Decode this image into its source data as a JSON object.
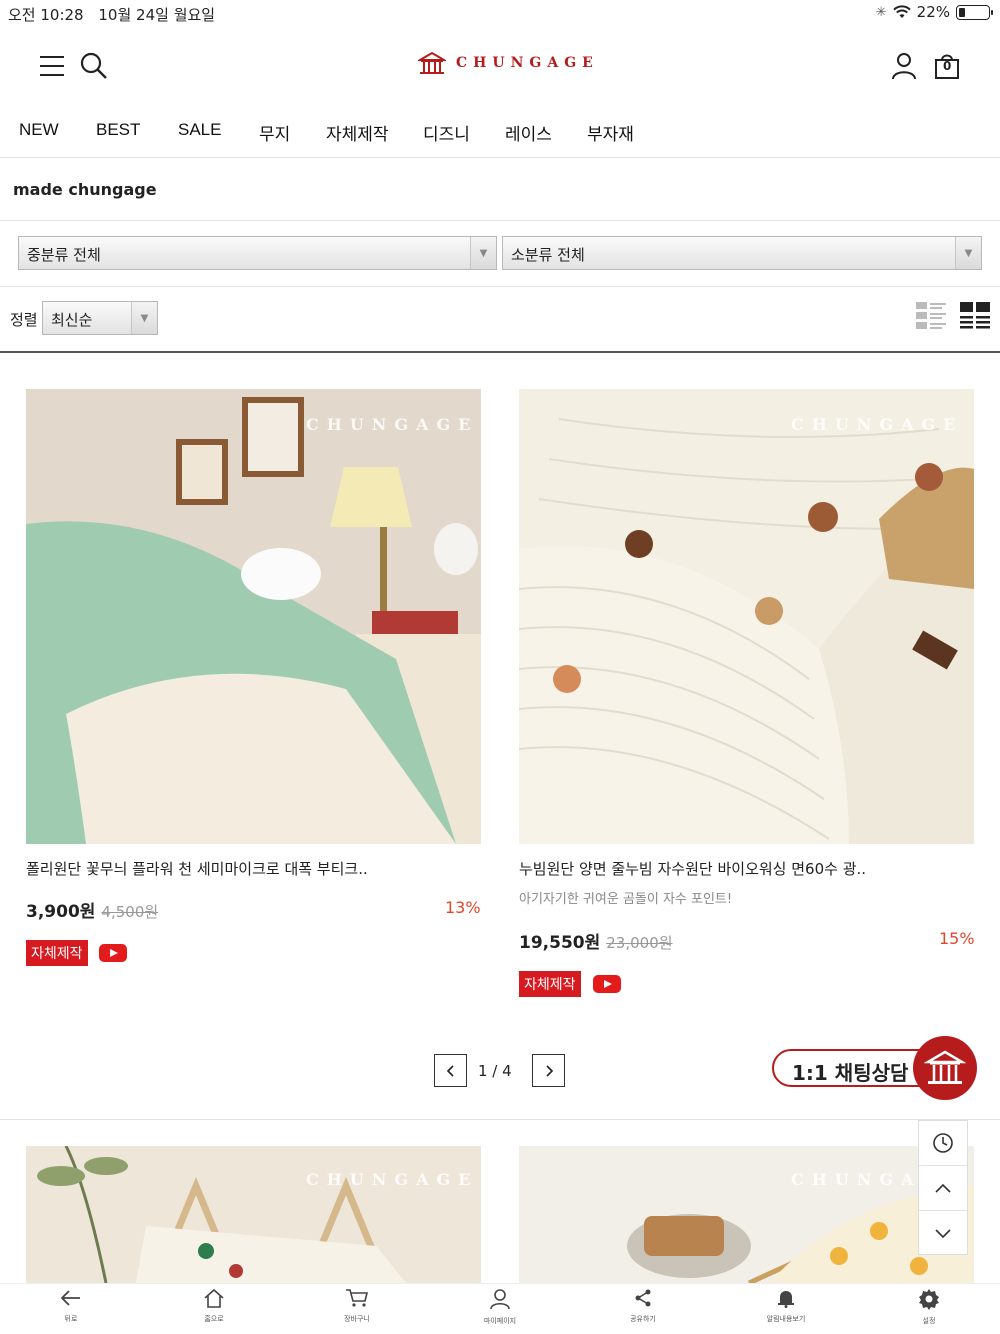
{
  "status_bar": {
    "time": "오전 10:28",
    "date": "10월 24일 월요일",
    "battery": "22%",
    "battery_level": 0.22
  },
  "header": {
    "logo_text": "CHUNGAGE",
    "cart_count": "0"
  },
  "nav": {
    "items": [
      "NEW",
      "BEST",
      "SALE",
      "무지",
      "자체제작",
      "디즈니",
      "레이스",
      "부자재"
    ]
  },
  "section": {
    "title": "made chungage"
  },
  "filters": {
    "mid_category": "중분류 전체",
    "sub_category": "소분류 전체",
    "sort_label": "정렬",
    "sort_value": "최신순"
  },
  "products": [
    {
      "watermark": "CHUNGAGE",
      "name": "폴리원단 꽃무늬 플라워 천 세미마이크로 대폭 부티크..",
      "desc": "",
      "price": "3,900원",
      "original_price": "4,500원",
      "discount": "13%",
      "tag": "자체제작"
    },
    {
      "watermark": "CHUNGAGE",
      "name": "누빔원단 양면 줄누빔 자수원단 바이오워싱 면60수 광..",
      "desc": "아기자기한 귀여운 곰돌이 자수 포인트!",
      "price": "19,550원",
      "original_price": "23,000원",
      "discount": "15%",
      "tag": "자체제작"
    },
    {
      "watermark": "CHUNGAGE"
    },
    {
      "watermark": "CHUNGA"
    }
  ],
  "pager": {
    "text": "1 / 4"
  },
  "chat": {
    "label": "1:1 채팅상담"
  },
  "bottom_bar": {
    "items": [
      "뒤로",
      "홈으로",
      "장바구니",
      "마이페이지",
      "공유하기",
      "알림내용보기",
      "설정"
    ]
  },
  "colors": {
    "brand": "#b71c1c",
    "discount": "#e0462a",
    "tag": "#d71920"
  }
}
